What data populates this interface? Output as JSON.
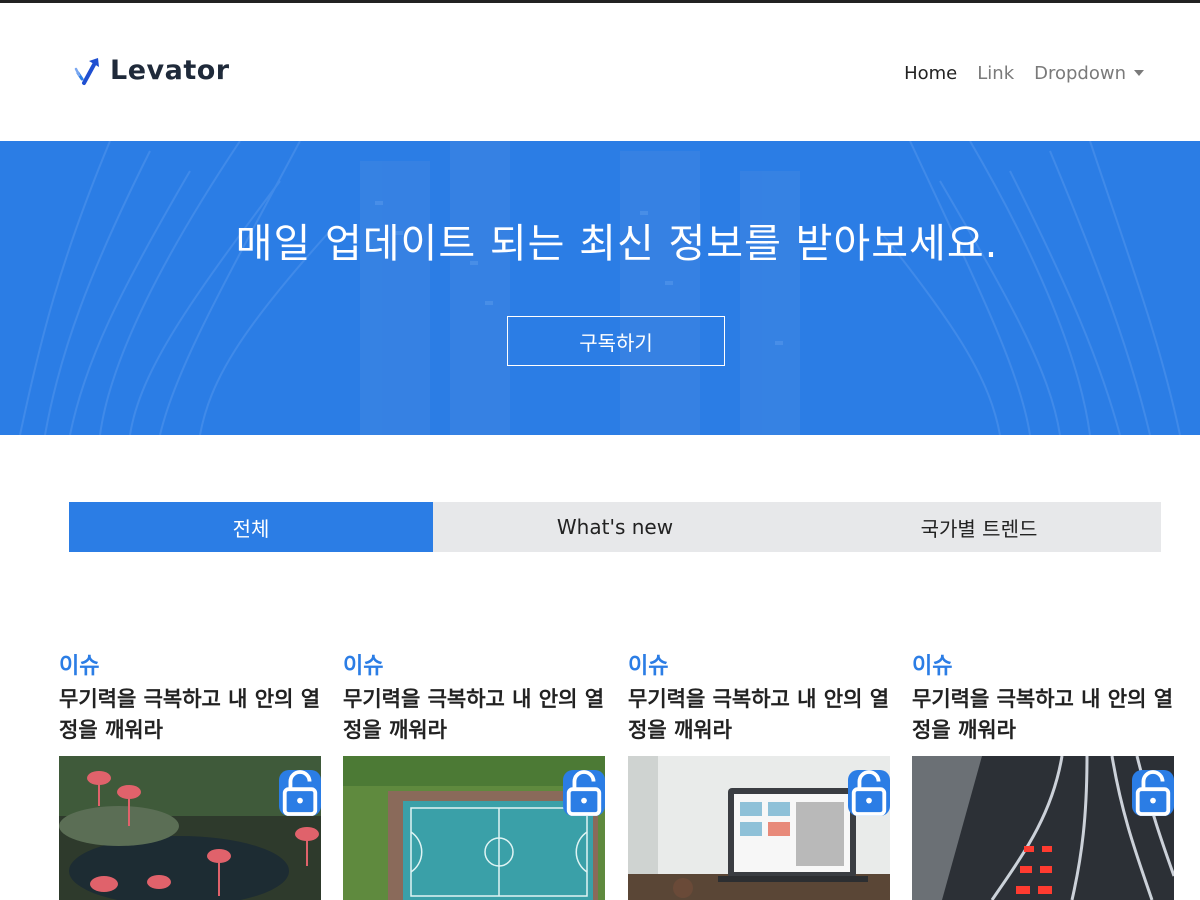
{
  "brand": {
    "name": "Levator",
    "icon": "arrow-up-right-logo-icon"
  },
  "nav": {
    "home": "Home",
    "link": "Link",
    "dropdown": "Dropdown"
  },
  "hero": {
    "title": "매일 업데이트 되는 최신 정보를 받아보세요.",
    "button": "구독하기"
  },
  "tabs": [
    {
      "label": "전체",
      "active": true
    },
    {
      "label": "What's new",
      "active": false
    },
    {
      "label": "국가별 트렌드",
      "active": false
    }
  ],
  "cards": [
    {
      "category": "이슈",
      "title": "무기력을 극복하고 내 안의 열정을 깨워라",
      "image": "flamingos-photo",
      "icon": "unlock-icon"
    },
    {
      "category": "이슈",
      "title": "무기력을 극복하고 내 안의 열정을 깨워라",
      "image": "basketball-court-aerial-photo",
      "icon": "unlock-icon"
    },
    {
      "category": "이슈",
      "title": "무기력을 극복하고 내 안의 열정을 깨워라",
      "image": "laptop-on-desk-photo",
      "icon": "unlock-icon"
    },
    {
      "category": "이슈",
      "title": "무기력을 극복하고 내 안의 열정을 깨워라",
      "image": "highway-light-trails-photo",
      "icon": "unlock-icon"
    }
  ],
  "colors": {
    "accent": "#2b7de5",
    "tab_bg": "#e7e8ea",
    "text_dark": "#222222",
    "nav_muted": "#7a7a7a"
  }
}
